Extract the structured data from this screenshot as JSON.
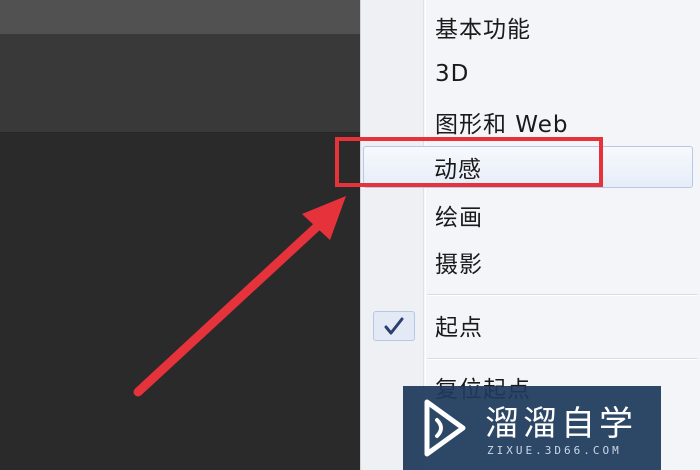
{
  "menu": {
    "items": [
      {
        "label": "基本功能"
      },
      {
        "label": "3D"
      },
      {
        "label": "图形和 Web"
      },
      {
        "label": "动感",
        "state": "hovered"
      },
      {
        "label": "绘画"
      },
      {
        "label": "摄影"
      },
      {
        "label": "起点",
        "checked": true
      },
      {
        "label": "复位起点"
      }
    ]
  },
  "annotation": {
    "color": "#e6323b",
    "target": "动感"
  },
  "watermark": {
    "title": "溜溜自学",
    "subtitle": "ZIXUE.3D66.COM"
  },
  "colors": {
    "menu_bg": "#f4f5f8",
    "hover_bg": "#e6edf8",
    "app_bg": "#2b2b2b",
    "watermark_bg": "#1f3a5c"
  }
}
